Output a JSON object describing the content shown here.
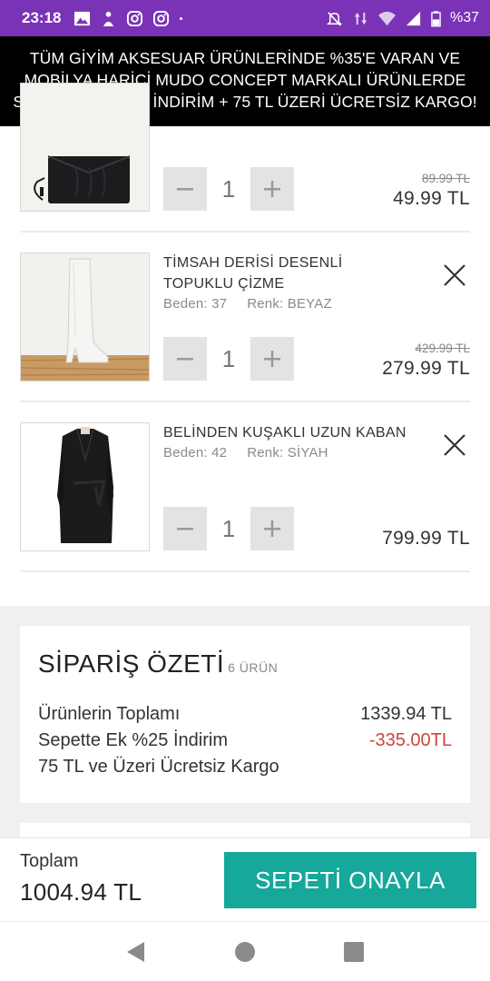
{
  "status_bar": {
    "time": "23:18",
    "battery": "%37",
    "icons": [
      "gallery-icon",
      "app-icon",
      "instagram-icon",
      "instagram-icon",
      "dot-icon",
      "mute-icon",
      "data-arrows-icon",
      "wifi-icon",
      "signal-icon",
      "battery-icon"
    ]
  },
  "promo": {
    "line1": "TÜM GİYİM AKSESUAR ÜRÜNLERİNDE %35'E VARAN VE",
    "line2": "MOBİLYA HARİCİ MUDO CONCEPT MARKALI ÜRÜNLERDE",
    "line3": "SEPETTE EK %25 İNDİRİM + 75 TL ÜZERİ ÜCRETSİZ KARGO!"
  },
  "cart": {
    "items": [
      {
        "name": "",
        "size": "",
        "color": "",
        "quantity": "1",
        "old_price": "89.99 TL",
        "price": "49.99 TL"
      },
      {
        "name": "TİMSAH DERİSİ DESENLİ TOPUKLU ÇİZME",
        "size": "Beden: 37",
        "color": "Renk: BEYAZ",
        "quantity": "1",
        "old_price": "429.99 TL",
        "price": "279.99 TL"
      },
      {
        "name": "BELİNDEN KUŞAKLI UZUN KABAN",
        "size": "Beden: 42",
        "color": "Renk: SİYAH",
        "quantity": "1",
        "old_price": "",
        "price": "799.99 TL"
      }
    ]
  },
  "summary": {
    "title": "SİPARİŞ ÖZETİ",
    "count": "6 ÜRÜN",
    "rows": [
      {
        "label": "Ürünlerin Toplamı",
        "value": "1339.94 TL"
      },
      {
        "label": "Sepette Ek %25 İndirim",
        "value": "-335.00TL"
      },
      {
        "label": "75 TL ve Üzeri Ücretsiz Kargo",
        "value": ""
      }
    ]
  },
  "checkout": {
    "total_label": "Toplam",
    "total_value": "1004.94 TL",
    "confirm_label": "SEPETİ ONAYLA"
  },
  "colors": {
    "status_bar": "#7a33b7",
    "promo_bg": "#000000",
    "confirm_button": "#15a89b",
    "discount": "#c9463d"
  }
}
